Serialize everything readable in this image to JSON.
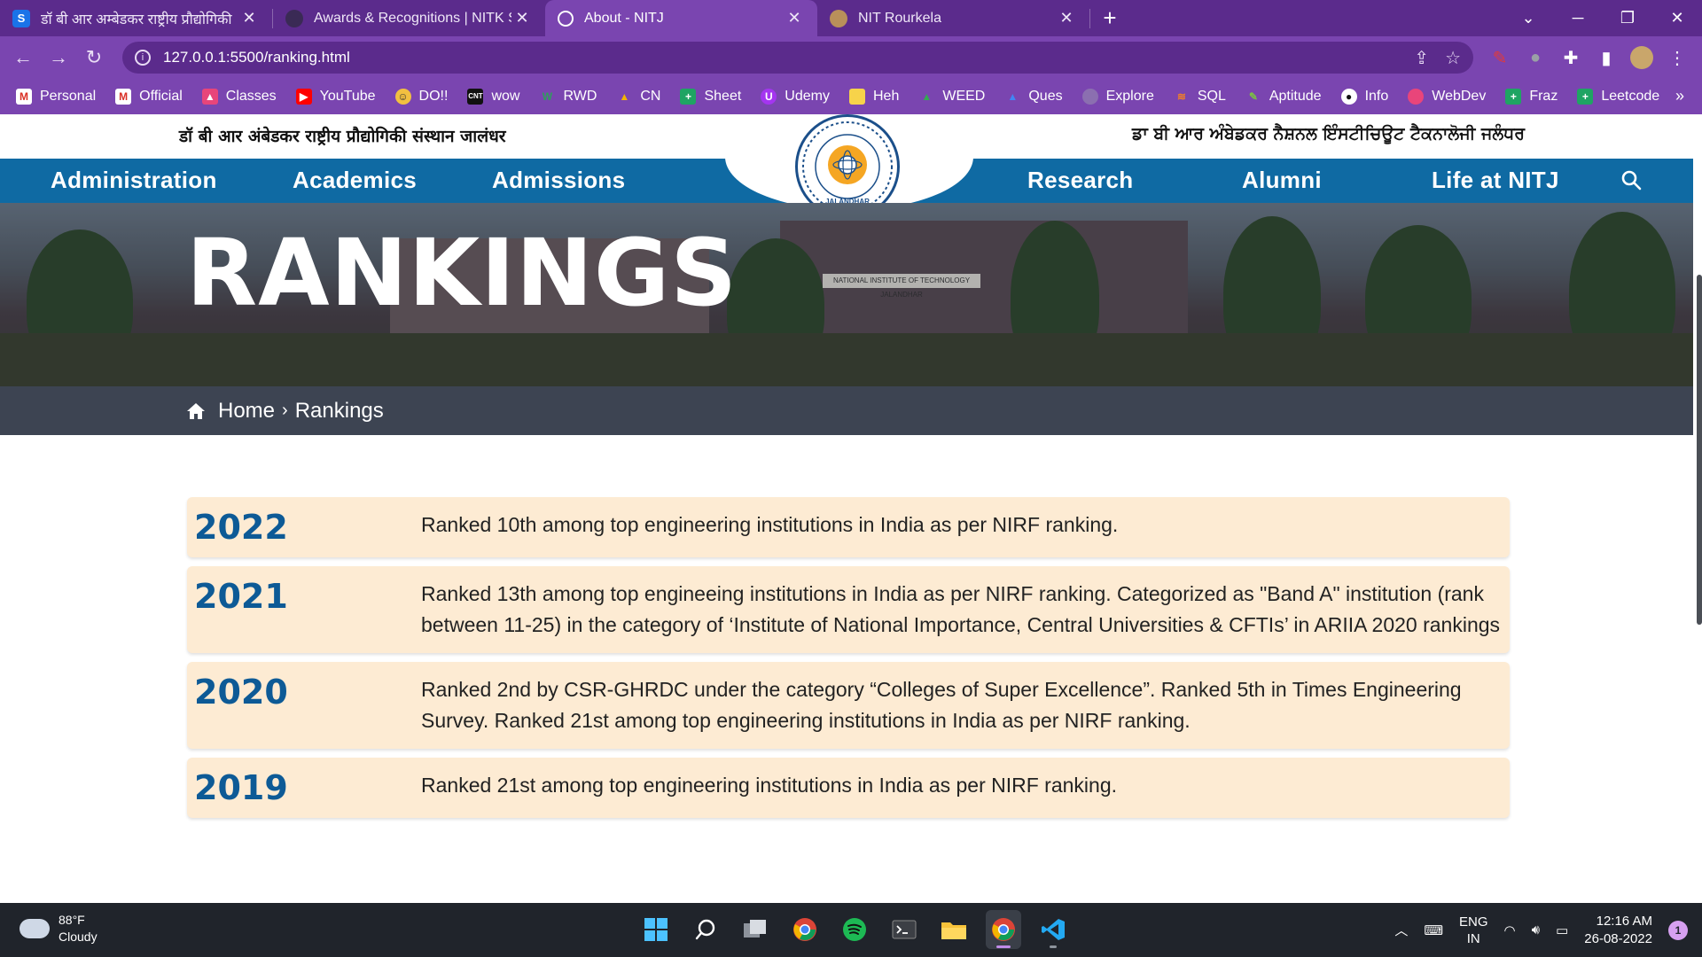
{
  "browser": {
    "tabs": [
      {
        "title": "डॉ बी आर अम्बेडकर राष्ट्रीय प्रौद्योगिकी",
        "favicon": "S",
        "active": false
      },
      {
        "title": "Awards & Recognitions | NITK Su",
        "favicon": "",
        "active": false
      },
      {
        "title": "About - NITJ",
        "favicon": "",
        "active": true
      },
      {
        "title": "NIT Rourkela",
        "favicon": "",
        "active": false
      }
    ],
    "url": "127.0.0.1:5500/ranking.html",
    "bookmarks": [
      "Personal",
      "Official",
      "Classes",
      "YouTube",
      "DO!!",
      "wow",
      "RWD",
      "CN",
      "Sheet",
      "Udemy",
      "Heh",
      "WEED",
      "Ques",
      "Explore",
      "SQL",
      "Aptitude",
      "Info",
      "WebDev",
      "Fraz",
      "Leetcode"
    ],
    "colors": {
      "frame": "#5b2b8c",
      "toolbar": "#7a45b0"
    }
  },
  "site": {
    "header_hindi": "डॉ बी आर अंबेडकर राष्ट्रीय प्रौद्योगिकी संस्थान जालंधर",
    "header_punjabi": "ਡਾ ਬੀ ਆਰ ਅੰਬੇਡਕਰ ਨੈਸ਼ਨਲ ਇੰਸਟੀਚਿਊਟ ਟੈਕਨਾਲੋਜੀ ਜਲੰਧਰ",
    "nav_left": [
      "Administration",
      "Academics",
      "Admissions"
    ],
    "nav_right": [
      "Research",
      "Alumni",
      "Life at NITJ"
    ],
    "logo_text": "JALANDHAR",
    "hero_title": "RANKINGS",
    "hero_sign": "NATIONAL INSTITUTE OF TECHNOLOGY JALANDHAR",
    "breadcrumb": {
      "home": "Home",
      "current": "Rankings"
    },
    "colors": {
      "nav": "#0f6aa3",
      "breadcrumb": "#3d4452",
      "card": "#fdebd3",
      "year": "#0d5a96"
    }
  },
  "rankings": [
    {
      "year": "2022",
      "text": "Ranked 10th among top engineering institutions in India as per NIRF ranking."
    },
    {
      "year": "2021",
      "text": "Ranked 13th among top engineeing institutions in India as per NIRF ranking. Categorized as \"Band A\" institution (rank between 11-25) in the category of ‘Institute of National Importance, Central Universities & CFTIs’ in ARIIA 2020 rankings"
    },
    {
      "year": "2020",
      "text": "Ranked 2nd by CSR-GHRDC under the category “Colleges of Super Excellence”. Ranked 5th in Times Engineering Survey. Ranked 21st among top engineering institutions in India as per NIRF ranking."
    },
    {
      "year": "2019",
      "text": "Ranked 21st among top engineering institutions in India as per NIRF ranking."
    }
  ],
  "taskbar": {
    "weather_temp": "88°F",
    "weather_desc": "Cloudy",
    "lang_top": "ENG",
    "lang_bottom": "IN",
    "time": "12:16 AM",
    "date": "26-08-2022",
    "notifications": "1"
  }
}
